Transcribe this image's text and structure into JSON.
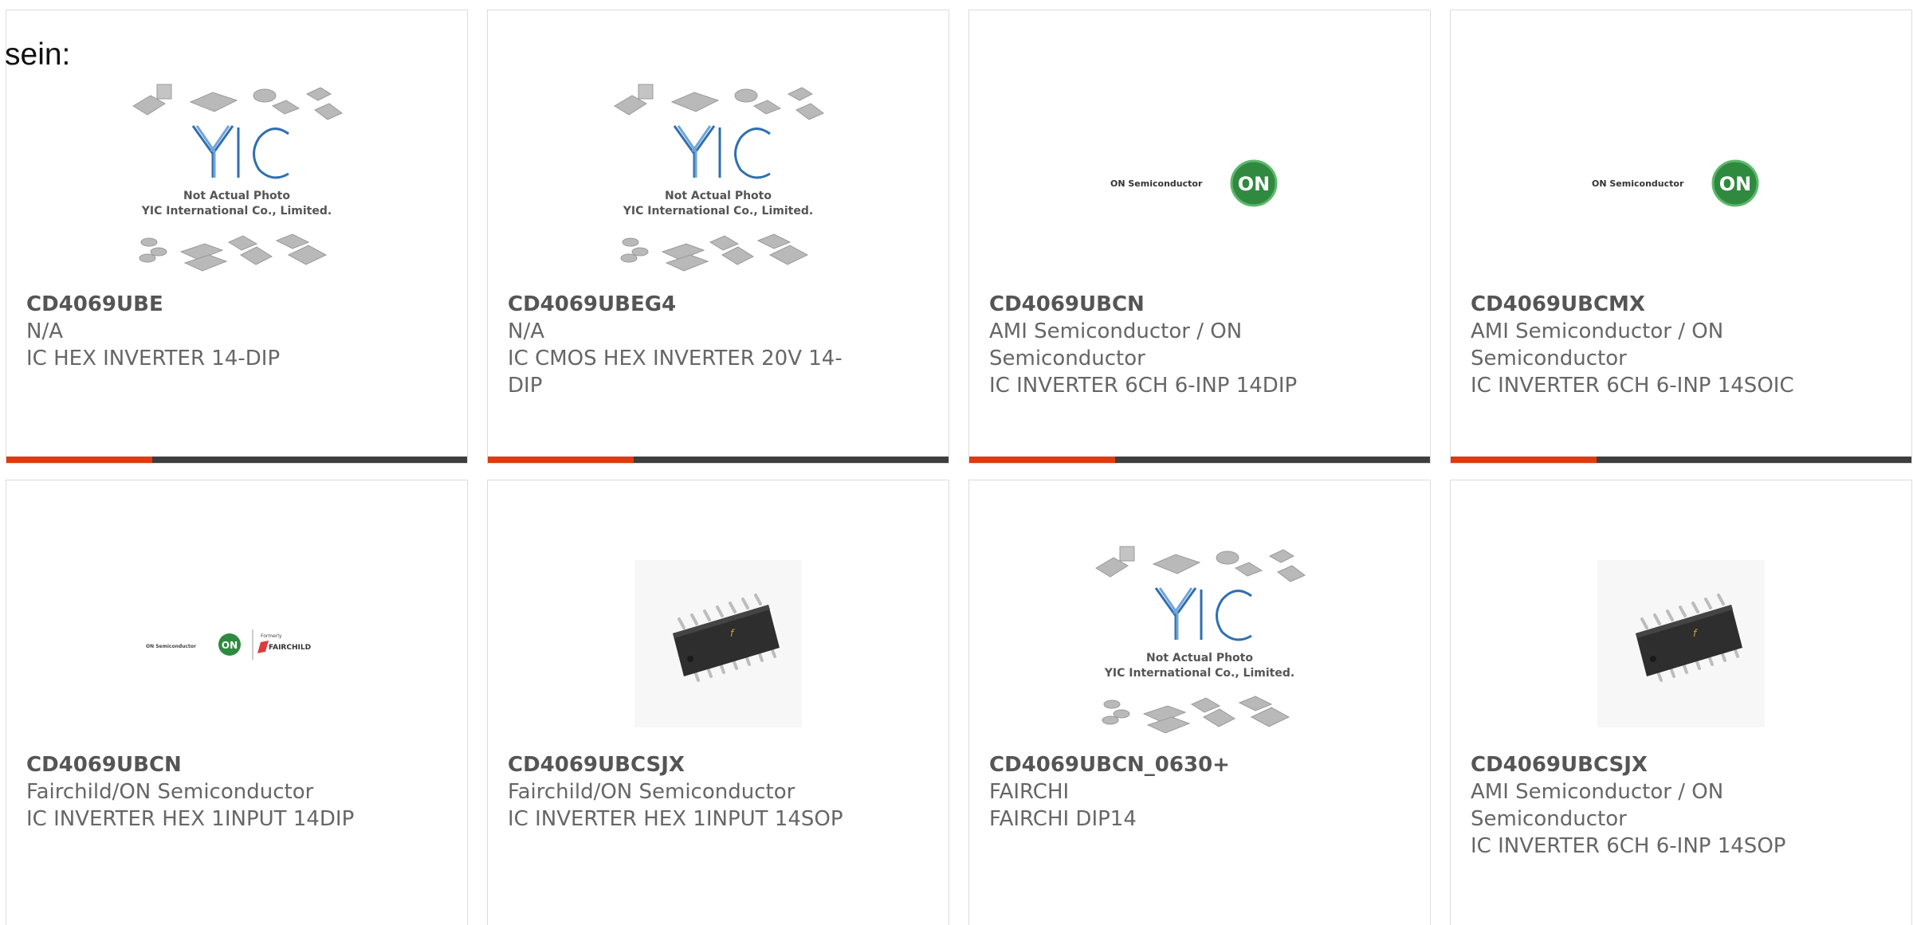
{
  "intro_text": "sein:",
  "placeholder": {
    "line1": "Not Actual Photo",
    "line2": "YIC International Co., Limited.",
    "logo": "YIC"
  },
  "on_logo": {
    "wordmark": "ON Semiconductor",
    "badge": "ON"
  },
  "fairchild_logo": {
    "small": "Formerly",
    "name": "FAIRCHILD"
  },
  "colors": {
    "accent_bar": "#e03a0f",
    "bar": "#3e3e3e",
    "on_green": "#2f8a3f",
    "yic_blue": "#2f6fb0"
  },
  "products": [
    {
      "part": "CD4069UBE",
      "maker": "N/A",
      "desc": "IC HEX INVERTER 14-DIP",
      "image": "placeholder"
    },
    {
      "part": "CD4069UBEG4",
      "maker": "N/A",
      "desc": "IC CMOS HEX INVERTER 20V 14-DIP",
      "image": "placeholder"
    },
    {
      "part": "CD4069UBCN",
      "maker": "AMI Semiconductor / ON Semiconductor",
      "desc": "IC INVERTER 6CH 6-INP 14DIP",
      "image": "on-logo"
    },
    {
      "part": "CD4069UBCMX",
      "maker": "AMI Semiconductor / ON Semiconductor",
      "desc": "IC INVERTER 6CH 6-INP 14SOIC",
      "image": "on-logo"
    },
    {
      "part": "CD4069UBCN",
      "maker": "Fairchild/ON Semiconductor",
      "desc": "IC INVERTER HEX 1INPUT 14DIP",
      "image": "on-fairchild-logo"
    },
    {
      "part": "CD4069UBCSJX",
      "maker": "Fairchild/ON Semiconductor",
      "desc": "IC INVERTER HEX 1INPUT 14SOP",
      "image": "soic-chip"
    },
    {
      "part": "CD4069UBCN_0630+",
      "maker": "FAIRCHI",
      "desc": "FAIRCHI DIP14",
      "image": "placeholder"
    },
    {
      "part": "CD4069UBCSJX",
      "maker": "AMI Semiconductor / ON Semiconductor",
      "desc": "IC INVERTER 6CH 6-INP 14SOP",
      "image": "soic-chip"
    }
  ]
}
